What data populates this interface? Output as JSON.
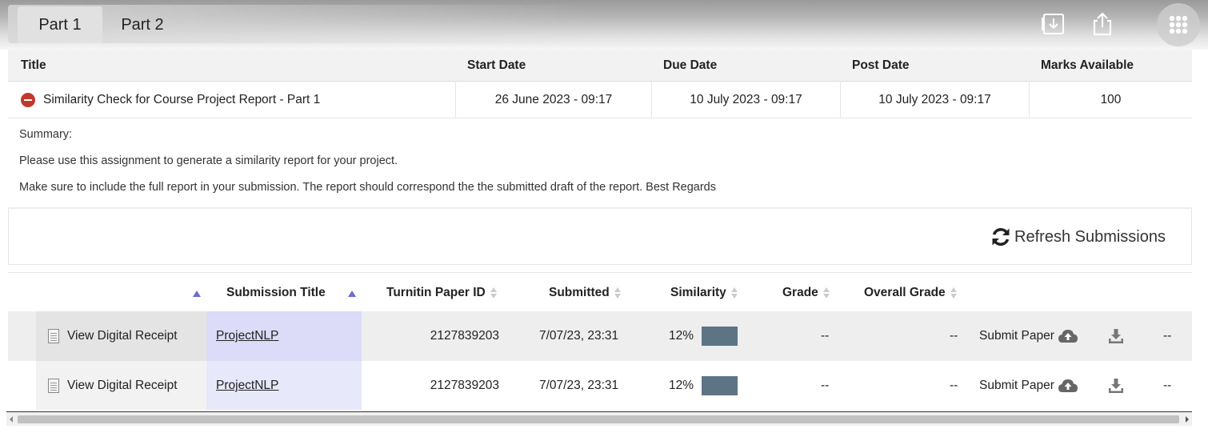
{
  "tabs": [
    {
      "label": "Part 1",
      "active": true
    },
    {
      "label": "Part 2",
      "active": false
    }
  ],
  "toolbar_icons": [
    "download-doc-icon",
    "share-icon",
    "app-launcher-grid-icon"
  ],
  "assignment": {
    "headers": [
      "Title",
      "Start Date",
      "Due Date",
      "Post Date",
      "Marks Available"
    ],
    "row": {
      "status_icon": "minus-circle-icon",
      "title": "Similarity Check for Course Project Report - Part 1",
      "start_date": "26 June 2023 - 09:17",
      "due_date": "10 July 2023 - 09:17",
      "post_date": "10 July 2023 - 09:17",
      "marks": "100"
    },
    "summary_label": "Summary:",
    "summary_lines": [
      "Please use this assignment to generate a similarity report for your project.",
      "Make sure to include the full report in your submission. The report should correspond the the submitted draft of the report. Best Regards"
    ]
  },
  "refresh_label": "Refresh Submissions",
  "submissions": {
    "headers": {
      "submission_title": "Submission Title",
      "paper_id": "Turnitin Paper ID",
      "submitted": "Submitted",
      "similarity": "Similarity",
      "grade": "Grade",
      "overall_grade": "Overall Grade"
    },
    "rows": [
      {
        "receipt": "View Digital Receipt",
        "title": "ProjectNLP",
        "paper_id": "2127839203",
        "submitted": "7/07/23, 23:31",
        "similarity": "12%",
        "similarity_value": 12,
        "grade": "--",
        "overall_grade": "--",
        "submit_paper": "Submit Paper",
        "last": "--"
      },
      {
        "receipt": "View Digital Receipt",
        "title": "ProjectNLP",
        "paper_id": "2127839203",
        "submitted": "7/07/23, 23:31",
        "similarity": "12%",
        "similarity_value": 12,
        "grade": "--",
        "overall_grade": "--",
        "submit_paper": "Submit Paper",
        "last": "--"
      }
    ]
  },
  "colors": {
    "similarity_bar": "#5d7484",
    "sort_active": "#6b6bd6",
    "status_icon": "#c0392b",
    "title_cell_bg": "#dcdcf8"
  }
}
